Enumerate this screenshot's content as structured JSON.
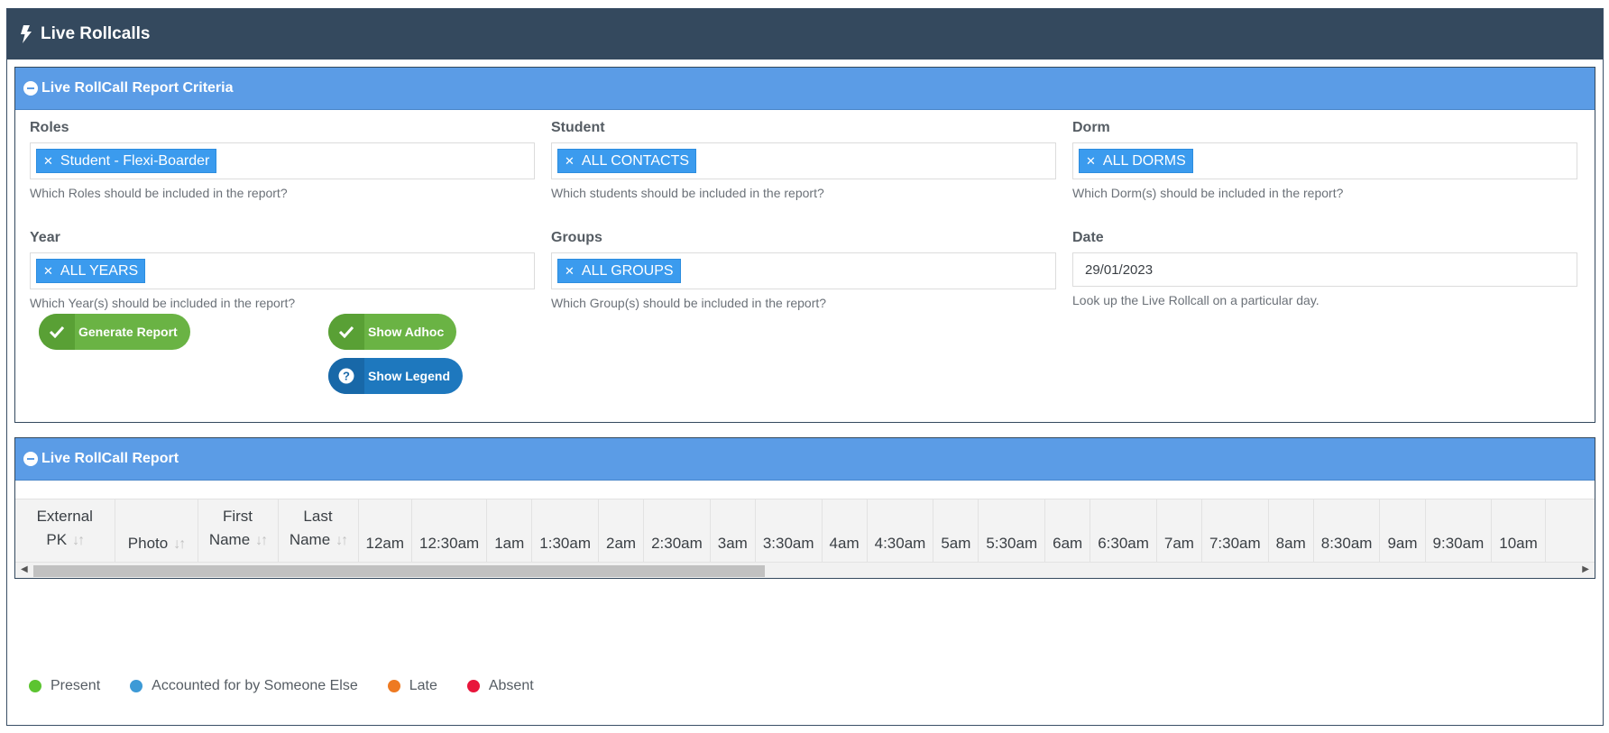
{
  "header": {
    "title": "Live Rollcalls"
  },
  "criteria": {
    "title": "Live RollCall Report Criteria",
    "roles": {
      "label": "Roles",
      "tag": "Student - Flexi-Boarder",
      "help": "Which Roles should be included in the report?"
    },
    "student": {
      "label": "Student",
      "tag": "ALL CONTACTS",
      "help": "Which students should be included in the report?"
    },
    "dorm": {
      "label": "Dorm",
      "tag": "ALL DORMS",
      "help": "Which Dorm(s) should be included in the report?"
    },
    "year": {
      "label": "Year",
      "tag": "ALL YEARS",
      "help": "Which Year(s) should be included in the report?"
    },
    "groups": {
      "label": "Groups",
      "tag": "ALL GROUPS",
      "help": "Which Group(s) should be included in the report?"
    },
    "date": {
      "label": "Date",
      "value": "29/01/2023",
      "help": "Look up the Live Rollcall on a particular day."
    },
    "buttons": {
      "generate": "Generate Report",
      "adhoc": "Show Adhoc",
      "legend": "Show Legend"
    }
  },
  "report": {
    "title": "Live RollCall Report",
    "columns": {
      "external_pk": [
        "External",
        "PK"
      ],
      "photo": "Photo",
      "first_name": [
        "First",
        "Name"
      ],
      "last_name": [
        "Last",
        "Name"
      ],
      "times": [
        "12am",
        "12:30am",
        "1am",
        "1:30am",
        "2am",
        "2:30am",
        "3am",
        "3:30am",
        "4am",
        "4:30am",
        "5am",
        "5:30am",
        "6am",
        "6:30am",
        "7am",
        "7:30am",
        "8am",
        "8:30am",
        "9am",
        "9:30am",
        "10am"
      ]
    }
  },
  "legend": [
    {
      "label": "Present",
      "color": "#5cc431"
    },
    {
      "label": "Accounted for by Someone Else",
      "color": "#3d9ad6"
    },
    {
      "label": "Late",
      "color": "#ee7a22"
    },
    {
      "label": "Absent",
      "color": "#e8153b"
    }
  ]
}
